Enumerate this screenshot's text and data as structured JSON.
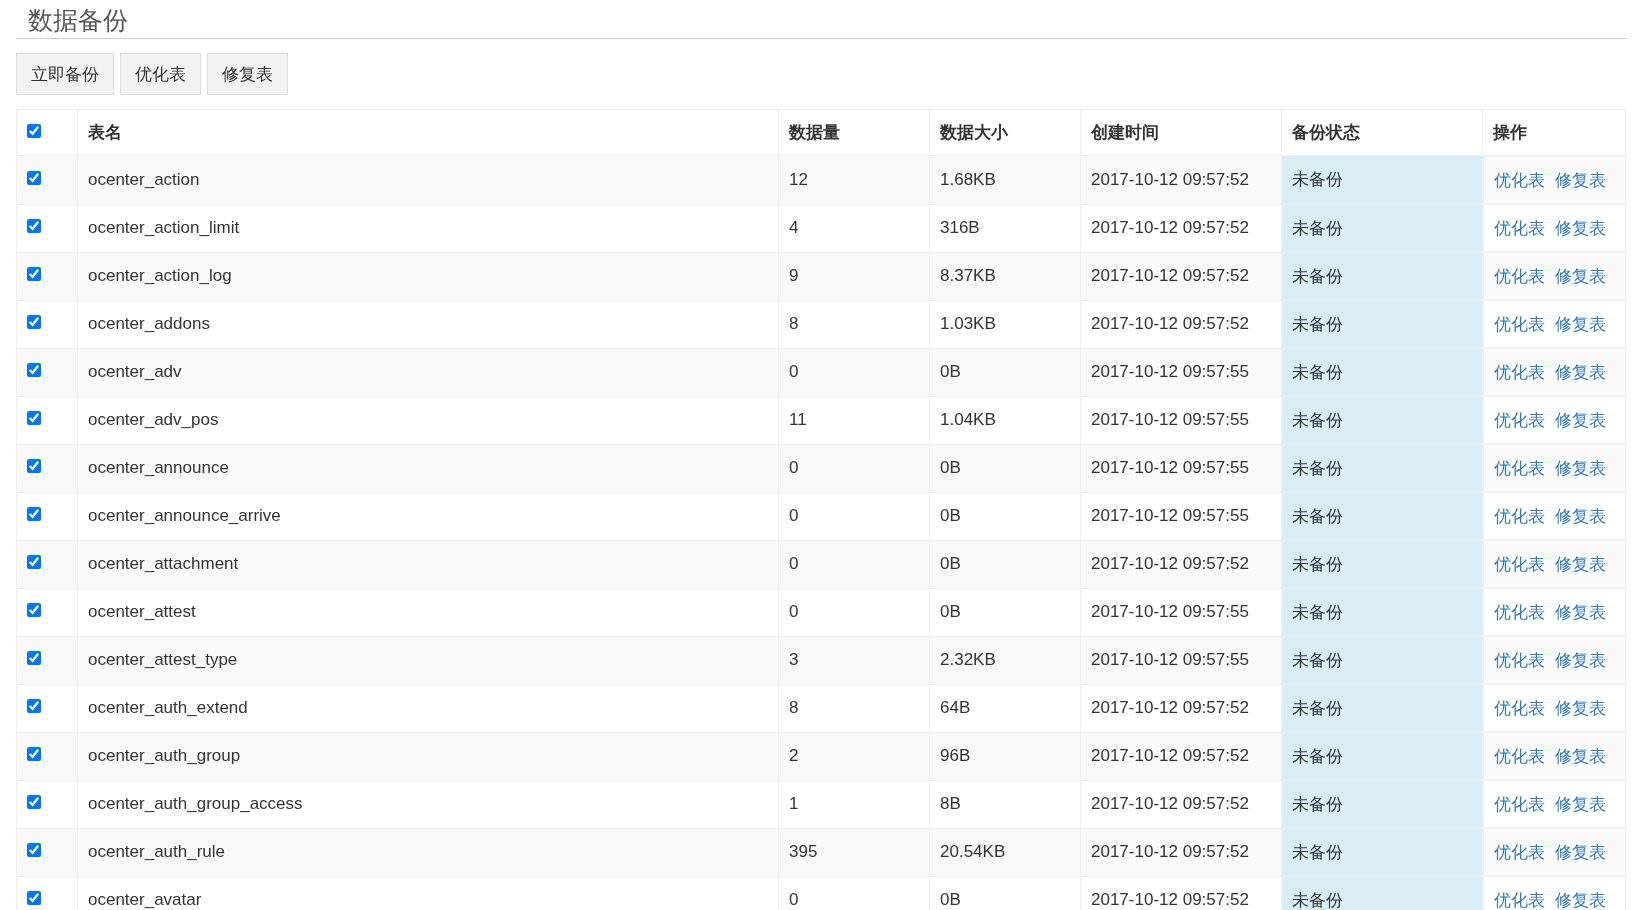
{
  "page_title": "数据备份",
  "toolbar": [
    "立即备份",
    "优化表",
    "修复表"
  ],
  "header": {
    "checked": true,
    "columns": [
      "表名",
      "数据量",
      "数据大小",
      "创建时间",
      "备份状态",
      "操作"
    ]
  },
  "rows": [
    {
      "checked": true,
      "name": "ocenter_action",
      "count": "12",
      "size": "1.68KB",
      "created": "2017-10-12 09:57:52",
      "status": "未备份",
      "actions": [
        "优化表",
        "修复表"
      ]
    },
    {
      "checked": true,
      "name": "ocenter_action_limit",
      "count": "4",
      "size": "316B",
      "created": "2017-10-12 09:57:52",
      "status": "未备份",
      "actions": [
        "优化表",
        "修复表"
      ]
    },
    {
      "checked": true,
      "name": "ocenter_action_log",
      "count": "9",
      "size": "8.37KB",
      "created": "2017-10-12 09:57:52",
      "status": "未备份",
      "actions": [
        "优化表",
        "修复表"
      ]
    },
    {
      "checked": true,
      "name": "ocenter_addons",
      "count": "8",
      "size": "1.03KB",
      "created": "2017-10-12 09:57:52",
      "status": "未备份",
      "actions": [
        "优化表",
        "修复表"
      ]
    },
    {
      "checked": true,
      "name": "ocenter_adv",
      "count": "0",
      "size": "0B",
      "created": "2017-10-12 09:57:55",
      "status": "未备份",
      "actions": [
        "优化表",
        "修复表"
      ]
    },
    {
      "checked": true,
      "name": "ocenter_adv_pos",
      "count": "11",
      "size": "1.04KB",
      "created": "2017-10-12 09:57:55",
      "status": "未备份",
      "actions": [
        "优化表",
        "修复表"
      ]
    },
    {
      "checked": true,
      "name": "ocenter_announce",
      "count": "0",
      "size": "0B",
      "created": "2017-10-12 09:57:55",
      "status": "未备份",
      "actions": [
        "优化表",
        "修复表"
      ]
    },
    {
      "checked": true,
      "name": "ocenter_announce_arrive",
      "count": "0",
      "size": "0B",
      "created": "2017-10-12 09:57:55",
      "status": "未备份",
      "actions": [
        "优化表",
        "修复表"
      ]
    },
    {
      "checked": true,
      "name": "ocenter_attachment",
      "count": "0",
      "size": "0B",
      "created": "2017-10-12 09:57:52",
      "status": "未备份",
      "actions": [
        "优化表",
        "修复表"
      ]
    },
    {
      "checked": true,
      "name": "ocenter_attest",
      "count": "0",
      "size": "0B",
      "created": "2017-10-12 09:57:55",
      "status": "未备份",
      "actions": [
        "优化表",
        "修复表"
      ]
    },
    {
      "checked": true,
      "name": "ocenter_attest_type",
      "count": "3",
      "size": "2.32KB",
      "created": "2017-10-12 09:57:55",
      "status": "未备份",
      "actions": [
        "优化表",
        "修复表"
      ]
    },
    {
      "checked": true,
      "name": "ocenter_auth_extend",
      "count": "8",
      "size": "64B",
      "created": "2017-10-12 09:57:52",
      "status": "未备份",
      "actions": [
        "优化表",
        "修复表"
      ]
    },
    {
      "checked": true,
      "name": "ocenter_auth_group",
      "count": "2",
      "size": "96B",
      "created": "2017-10-12 09:57:52",
      "status": "未备份",
      "actions": [
        "优化表",
        "修复表"
      ]
    },
    {
      "checked": true,
      "name": "ocenter_auth_group_access",
      "count": "1",
      "size": "8B",
      "created": "2017-10-12 09:57:52",
      "status": "未备份",
      "actions": [
        "优化表",
        "修复表"
      ]
    },
    {
      "checked": true,
      "name": "ocenter_auth_rule",
      "count": "395",
      "size": "20.54KB",
      "created": "2017-10-12 09:57:52",
      "status": "未备份",
      "actions": [
        "优化表",
        "修复表"
      ]
    },
    {
      "checked": true,
      "name": "ocenter_avatar",
      "count": "0",
      "size": "0B",
      "created": "2017-10-12 09:57:52",
      "status": "未备份",
      "actions": [
        "优化表",
        "修复表"
      ]
    }
  ]
}
